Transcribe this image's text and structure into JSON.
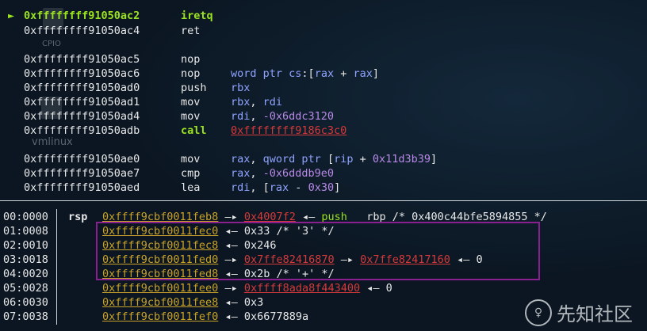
{
  "background": {
    "desktop_icon_labels": [
      "CPIO",
      "vmlinux"
    ]
  },
  "disasm": [
    {
      "current": true,
      "marker": "►",
      "addr": "0xffffffff91050ac2",
      "mnemonic": "iretq",
      "operands": []
    },
    {
      "addr": "0xffffffff91050ac4",
      "mnemonic": "ret",
      "operands": []
    },
    {
      "addr": "0xffffffff91050ac5",
      "mnemonic": "nop",
      "operands": []
    },
    {
      "addr": "0xffffffff91050ac6",
      "mnemonic": "nop",
      "operands": [
        {
          "t": "word ptr ",
          "c": "blue"
        },
        {
          "t": "cs",
          "c": "blue"
        },
        {
          "t": ":[",
          "c": "white"
        },
        {
          "t": "rax",
          "c": "blue"
        },
        {
          "t": " + ",
          "c": "white"
        },
        {
          "t": "rax",
          "c": "blue"
        },
        {
          "t": "]",
          "c": "white"
        }
      ]
    },
    {
      "addr": "0xffffffff91050ad0",
      "mnemonic": "push",
      "operands": [
        {
          "t": "rbx",
          "c": "blue"
        }
      ]
    },
    {
      "addr": "0xffffffff91050ad1",
      "mnemonic": "mov",
      "operands": [
        {
          "t": "rbx",
          "c": "blue"
        },
        {
          "t": ", ",
          "c": "white"
        },
        {
          "t": "rdi",
          "c": "blue"
        }
      ]
    },
    {
      "addr": "0xffffffff91050ad4",
      "mnemonic": "mov",
      "operands": [
        {
          "t": "rdi",
          "c": "blue"
        },
        {
          "t": ", ",
          "c": "white"
        },
        {
          "t": "-0x6ddc3120",
          "c": "purple"
        }
      ]
    },
    {
      "addr": "0xffffffff91050adb",
      "mnemonic": "call",
      "call": true,
      "operands": [
        {
          "t": "0xffffffff9186c3c0",
          "c": "red"
        }
      ]
    },
    {
      "addr": "0xffffffff91050ae0",
      "mnemonic": "mov",
      "operands": [
        {
          "t": "rax",
          "c": "blue"
        },
        {
          "t": ", ",
          "c": "white"
        },
        {
          "t": "qword ptr ",
          "c": "blue"
        },
        {
          "t": "[",
          "c": "white"
        },
        {
          "t": "rip",
          "c": "blue"
        },
        {
          "t": " + ",
          "c": "white"
        },
        {
          "t": "0x11d3b39",
          "c": "purple"
        },
        {
          "t": "]",
          "c": "white"
        }
      ]
    },
    {
      "addr": "0xffffffff91050ae7",
      "mnemonic": "cmp",
      "operands": [
        {
          "t": "rax",
          "c": "blue"
        },
        {
          "t": ", ",
          "c": "white"
        },
        {
          "t": "-0x6dddb9e0",
          "c": "purple"
        }
      ]
    },
    {
      "addr": "0xffffffff91050aed",
      "mnemonic": "lea",
      "operands": [
        {
          "t": "rdi",
          "c": "blue"
        },
        {
          "t": ", [",
          "c": "white"
        },
        {
          "t": "rax",
          "c": "blue"
        },
        {
          "t": " - ",
          "c": "white"
        },
        {
          "t": "0x30",
          "c": "purple"
        },
        {
          "t": "]",
          "c": "white"
        }
      ]
    }
  ],
  "stack": [
    {
      "idx": "00:0000",
      "reg": "rsp",
      "parts": [
        {
          "t": "0xffff9cbf0011feb8",
          "c": "gold"
        },
        {
          "t": " —▸ ",
          "c": "white"
        },
        {
          "t": "0x4007f2",
          "c": "red"
        },
        {
          "t": " ◂— ",
          "c": "white"
        },
        {
          "t": "push",
          "c": "green"
        },
        {
          "t": "   rbp /* 0x400c44bfe5894855 */",
          "c": "white"
        }
      ]
    },
    {
      "idx": "01:0008",
      "reg": "",
      "parts": [
        {
          "t": "0xffff9cbf0011fec0",
          "c": "gold"
        },
        {
          "t": " ◂— 0x33 /* '3' */",
          "c": "white"
        }
      ]
    },
    {
      "idx": "02:0010",
      "reg": "",
      "parts": [
        {
          "t": "0xffff9cbf0011fec8",
          "c": "gold"
        },
        {
          "t": " ◂— 0x246",
          "c": "white"
        }
      ]
    },
    {
      "idx": "03:0018",
      "reg": "",
      "parts": [
        {
          "t": "0xffff9cbf0011fed0",
          "c": "gold"
        },
        {
          "t": " —▸ ",
          "c": "white"
        },
        {
          "t": "0x7ffe82416870",
          "c": "red"
        },
        {
          "t": " —▸ ",
          "c": "white"
        },
        {
          "t": "0x7ffe82417160",
          "c": "red"
        },
        {
          "t": " ◂— 0",
          "c": "white"
        }
      ]
    },
    {
      "idx": "04:0020",
      "reg": "",
      "parts": [
        {
          "t": "0xffff9cbf0011fed8",
          "c": "gold"
        },
        {
          "t": " ◂— 0x2b /* '+' */",
          "c": "white"
        }
      ]
    },
    {
      "idx": "05:0028",
      "reg": "",
      "parts": [
        {
          "t": "0xffff9cbf0011fee0",
          "c": "gold"
        },
        {
          "t": " —▸ ",
          "c": "white"
        },
        {
          "t": "0xffff8ada8f443400",
          "c": "red"
        },
        {
          "t": " ◂— 0",
          "c": "white"
        }
      ]
    },
    {
      "idx": "06:0030",
      "reg": "",
      "parts": [
        {
          "t": "0xffff9cbf0011fee8",
          "c": "gold"
        },
        {
          "t": " ◂— 0x3",
          "c": "white"
        }
      ]
    },
    {
      "idx": "07:0038",
      "reg": "",
      "parts": [
        {
          "t": "0xffff9cbf0011fef0",
          "c": "gold"
        },
        {
          "t": " ◂— 0x6677889a",
          "c": "white"
        }
      ]
    }
  ],
  "watermark": {
    "logo": "♀",
    "text": "先知社区"
  }
}
